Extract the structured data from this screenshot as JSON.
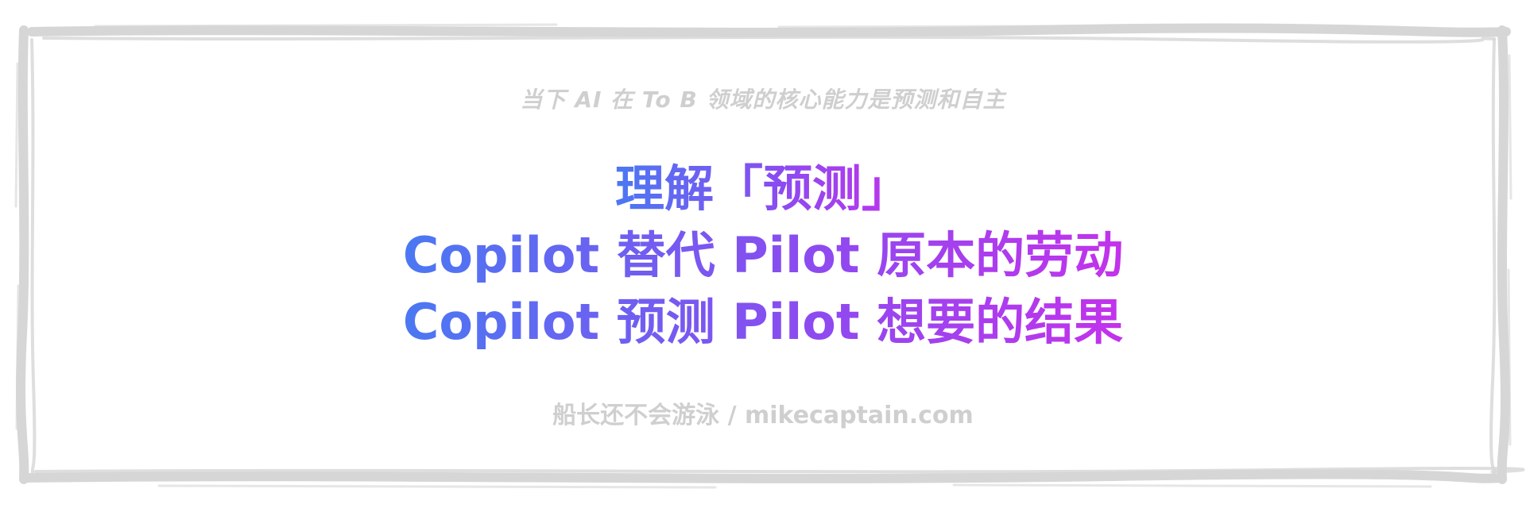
{
  "subtitle": "当下 AI 在 To B 领域的核心能力是预测和自主",
  "headline": {
    "line1": "理解「预测」",
    "line2": "Copilot 替代 Pilot 原本的劳动",
    "line3": "Copilot 预测 Pilot 想要的结果"
  },
  "footer": "船长还不会游泳 / mikecaptain.com",
  "colors": {
    "frame": "#d6d6d6",
    "gradient_start": "#4b78f2",
    "gradient_mid": "#8a4cf0",
    "gradient_end": "#c332ec",
    "muted_text": "#cfcfcf"
  }
}
